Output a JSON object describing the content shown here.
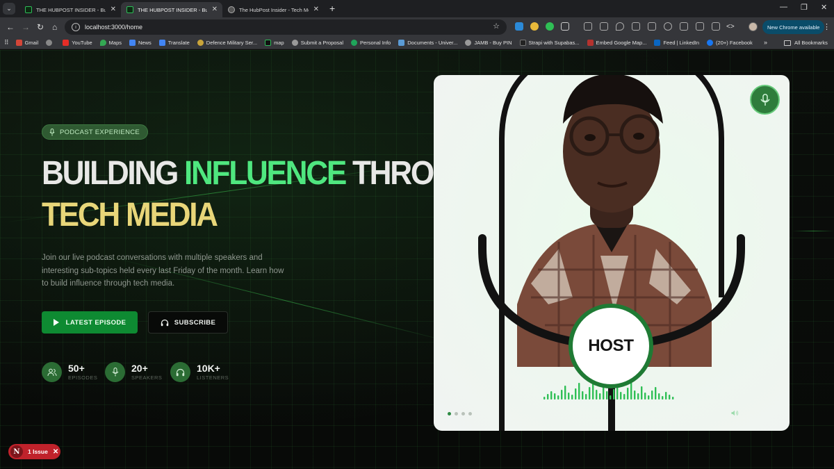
{
  "browser": {
    "tabs": [
      {
        "title": "THE HUBPOST INSIDER - Buildi",
        "active": false
      },
      {
        "title": "THE HUBPOST INSIDER - Buildi",
        "active": true
      },
      {
        "title": "The HubPost Insider - Tech Med",
        "active": false
      }
    ],
    "url": "localhost:3000/home",
    "new_chrome_label": "New Chrome available",
    "bookmarks": [
      "Gmail",
      "YouTube",
      "Maps",
      "News",
      "Translate",
      "Defence Military Ser...",
      "map",
      "Submit a Proposal",
      "Personal Info",
      "Documents - Univer...",
      "JAMB - Buy PIN",
      "Strapi with Supabas...",
      "Embed Google Map...",
      "Feed | LinkedIn",
      "(20+) Facebook"
    ],
    "all_bookmarks_label": "All Bookmarks"
  },
  "hero": {
    "badge": "PODCAST EXPERIENCE",
    "headline": {
      "w1": "BUILDING",
      "w2": "INFLUENCE",
      "w3": "THROUGH",
      "w4": "TECH MEDIA"
    },
    "description": "Join our live podcast conversations with multiple speakers and interesting sub-topics held every last Friday of the month. Learn how to build influence through tech media.",
    "primary_button": "LATEST EPISODE",
    "secondary_button": "SUBSCRIBE",
    "stats": [
      {
        "value": "50+",
        "label": "EPISODES",
        "icon": "users-icon"
      },
      {
        "value": "20+",
        "label": "SPEAKERS",
        "icon": "mic-icon"
      },
      {
        "value": "10K+",
        "label": "LISTENERS",
        "icon": "headphones-icon"
      }
    ]
  },
  "card": {
    "host_label": "HOST",
    "slides_count": 4,
    "active_slide": 1
  },
  "devtools": {
    "issue_label": "1 Issue",
    "logo_letter": "N"
  },
  "colors": {
    "accent_green": "#4fe77f",
    "accent_yellow": "#e8d679",
    "button_green": "#0e8a32",
    "issue_red": "#c0222b"
  }
}
